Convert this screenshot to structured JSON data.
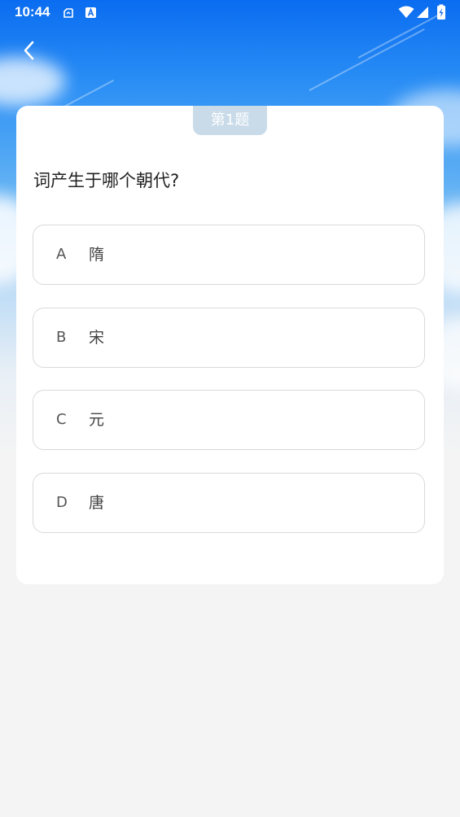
{
  "status_bar": {
    "time": "10:44"
  },
  "navigation": {
    "back_icon": "chevron-left-icon"
  },
  "quiz": {
    "question_number_label": "第1题",
    "question": "词产生于哪个朝代?",
    "options": [
      {
        "letter": "A",
        "text": "隋"
      },
      {
        "letter": "B",
        "text": "宋"
      },
      {
        "letter": "C",
        "text": "元"
      },
      {
        "letter": "D",
        "text": "唐"
      }
    ]
  },
  "colors": {
    "sky_top": "#0a6cf0",
    "page_background": "#f4f4f4",
    "tag_background": "#c9dbe9",
    "option_border": "#d9d9d9"
  }
}
